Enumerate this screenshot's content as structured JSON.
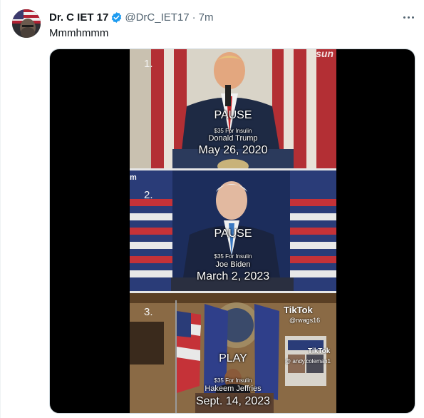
{
  "tweet": {
    "display_name": "Dr. C IET 17",
    "handle": "@DrC_IET17",
    "separator": "·",
    "time": "7m",
    "text": "Mmmhmmm",
    "verified_color": "#1d9bf0"
  },
  "video": {
    "watermark_top": "sun",
    "watermark_mid": "m",
    "panels": [
      {
        "number": "1.",
        "status": "PAUSE",
        "subtitle": "$35 For Insulin",
        "name": "Donald Trump",
        "date": "May 26, 2020"
      },
      {
        "number": "2.",
        "status": "PAUSE",
        "subtitle": "$35 For Insulin",
        "name": "Joe Biden",
        "date": "March 2, 2023"
      },
      {
        "number": "3.",
        "status": "PLAY",
        "subtitle": "$35 For Insulin",
        "name": "Hakeem Jeffries",
        "date": "Sept. 14, 2023"
      }
    ],
    "tiktok": {
      "logo_1": "TikTok",
      "user_1": "@rwags16",
      "logo_2": "TikTok",
      "user_2": "@ andy.coleman1"
    }
  }
}
